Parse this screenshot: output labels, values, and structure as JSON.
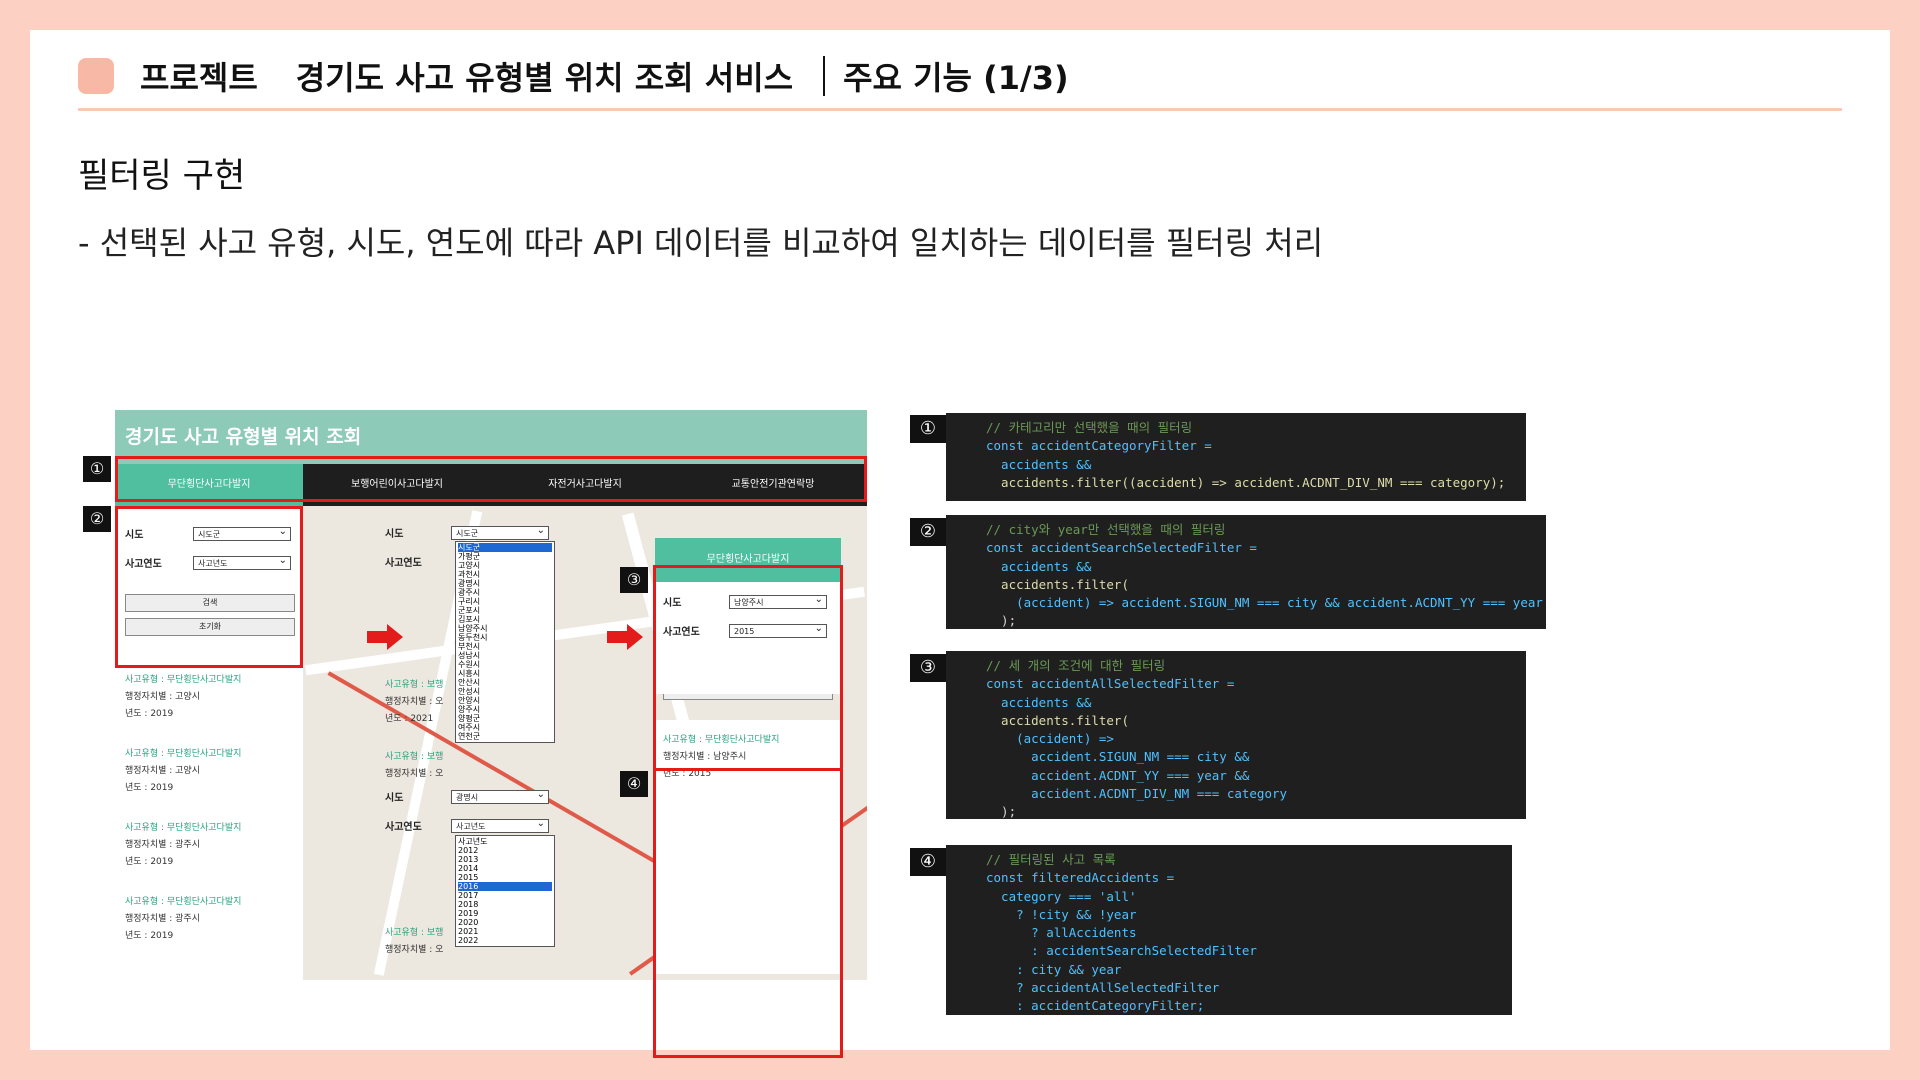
{
  "header": {
    "project_label": "프로젝트",
    "project_title": "경기도 사고 유형별 위치 조회 서비스",
    "section": "주요 기능 (1/3)"
  },
  "section_title": "필터링 구현",
  "description": "- 선택된 사고 유형, 시도, 연도에 따라 API 데이터를 비교하여 일치하는 데이터를 필터링 처리",
  "app": {
    "title": "경기도 사고 유형별 위치 조회",
    "tabs": [
      "무단횡단사고다발지",
      "보행어린이사고다발지",
      "자전거사고다발지",
      "교통안전기관연락망"
    ],
    "form": {
      "city_label": "시도",
      "year_label": "사고연도",
      "city_placeholder": "시도군",
      "year_placeholder": "사고년도",
      "search_btn": "검색",
      "reset_btn": "초기화"
    },
    "results": [
      {
        "type_label": "사고유형 : 무단횡단사고다발지",
        "city_label": "행정자치별 : 고양시",
        "year_label": "년도 : 2019"
      },
      {
        "type_label": "사고유형 : 무단횡단사고다발지",
        "city_label": "행정자치별 : 고양시",
        "year_label": "년도 : 2019"
      },
      {
        "type_label": "사고유형 : 무단횡단사고다발지",
        "city_label": "행정자치별 : 광주시",
        "year_label": "년도 : 2019"
      },
      {
        "type_label": "사고유형 : 무단횡단사고다발지",
        "city_label": "행정자치별 : 광주시",
        "year_label": "년도 : 2019"
      }
    ],
    "middle": {
      "city_select": "시도군",
      "city_options": [
        "시도군",
        "가평군",
        "고양시",
        "과천시",
        "광명시",
        "광주시",
        "구리시",
        "군포시",
        "김포시",
        "남양주시",
        "동두천시",
        "부천시",
        "성남시",
        "수원시",
        "시흥시",
        "안산시",
        "안성시",
        "안양시",
        "양주시",
        "양평군",
        "여주시",
        "연천군"
      ],
      "partial_result": {
        "type_label": "사고유형 : 보행",
        "city_label": "행정자치별 : 오",
        "year_label": "년도 : 2021"
      },
      "city_select2": "광명시",
      "year_select": "사고년도",
      "year_options": [
        "사고년도",
        "2012",
        "2013",
        "2014",
        "2015",
        "2016",
        "2017",
        "2018",
        "2019",
        "2020",
        "2021",
        "2022"
      ],
      "partial_result2": {
        "type_label": "사고유형 : 보행",
        "city_label": "행정자치별 : 오"
      },
      "partial_result3": {
        "type_label": "사고유형 : 보행",
        "city_label": "행정자치별 : 오"
      }
    },
    "right_panel": {
      "tab": "무단횡단사고다발지",
      "city_value": "남양주시",
      "year_value": "2015",
      "result": {
        "type_label": "사고유형 : 무단횡단사고다발지",
        "city_label": "행정자치별 : 남양주시",
        "year_label": "년도 : 2015"
      }
    },
    "markers": [
      "①",
      "②",
      "③",
      "④"
    ]
  },
  "code_blocks": [
    {
      "num": "①",
      "lines": [
        "// 카테고리만 선택했을 때의 필터링",
        "const accidentCategoryFilter =",
        "  accidents &&",
        "  accidents.filter((accident) => accident.ACDNT_DIV_NM === category);"
      ]
    },
    {
      "num": "②",
      "lines": [
        "// city와 year만 선택했을 때의 필터링",
        "const accidentSearchSelectedFilter =",
        "  accidents &&",
        "  accidents.filter(",
        "    (accident) => accident.SIGUN_NM === city && accident.ACDNT_YY === year",
        "  );"
      ]
    },
    {
      "num": "③",
      "lines": [
        "// 세 개의 조건에 대한 필터링",
        "const accidentAllSelectedFilter =",
        "  accidents &&",
        "  accidents.filter(",
        "    (accident) =>",
        "      accident.SIGUN_NM === city &&",
        "      accident.ACDNT_YY === year &&",
        "      accident.ACDNT_DIV_NM === category",
        "  );"
      ]
    },
    {
      "num": "④",
      "lines": [
        "// 필터링된 사고 목록",
        "const filteredAccidents =",
        "  category === 'all'",
        "    ? !city && !year",
        "      ? allAccidents",
        "      : accidentSearchSelectedFilter",
        "    : city && year",
        "    ? accidentAllSelectedFilter",
        "    : accidentCategoryFilter;"
      ]
    }
  ]
}
